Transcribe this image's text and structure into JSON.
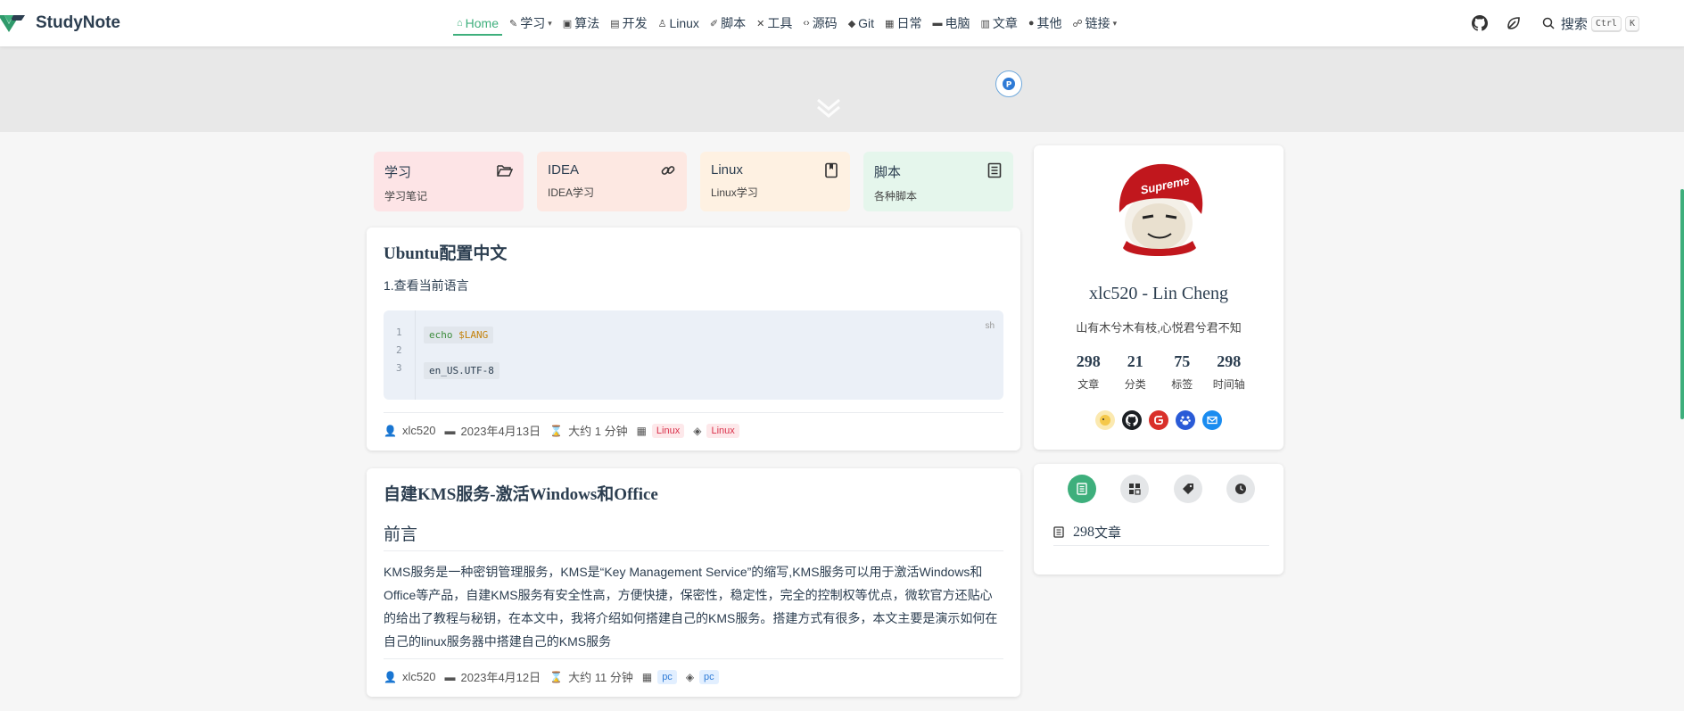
{
  "brand": {
    "name": "StudyNote"
  },
  "nav": {
    "items": [
      {
        "label": "Home",
        "icon": "home-icon",
        "active": true
      },
      {
        "label": "学习",
        "icon": "edit-icon",
        "dropdown": true
      },
      {
        "label": "算法",
        "icon": "terminal-icon"
      },
      {
        "label": "开发",
        "icon": "code-box-icon"
      },
      {
        "label": "Linux",
        "icon": "linux-icon"
      },
      {
        "label": "脚本",
        "icon": "script-icon"
      },
      {
        "label": "工具",
        "icon": "tools-icon"
      },
      {
        "label": "源码",
        "icon": "source-code-icon"
      },
      {
        "label": "Git",
        "icon": "git-icon"
      },
      {
        "label": "日常",
        "icon": "calendar-icon"
      },
      {
        "label": "电脑",
        "icon": "computer-icon"
      },
      {
        "label": "文章",
        "icon": "document-icon"
      },
      {
        "label": "其他",
        "icon": "other-icon"
      },
      {
        "label": "链接",
        "icon": "link-icon",
        "dropdown": true
      }
    ]
  },
  "search": {
    "label": "搜索",
    "key1": "Ctrl",
    "key2": "K"
  },
  "categories": [
    {
      "title": "学习",
      "desc": "学习笔记",
      "icon": "folder-open-icon",
      "bg": "#fde4e6"
    },
    {
      "title": "IDEA",
      "desc": "IDEA学习",
      "icon": "link-icon",
      "bg": "#fde8e2"
    },
    {
      "title": "Linux",
      "desc": "Linux学习",
      "icon": "bookmark-book-icon",
      "bg": "#fef1e2"
    },
    {
      "title": "脚本",
      "desc": "各种脚本",
      "icon": "list-doc-icon",
      "bg": "#e5f6ec"
    }
  ],
  "articles": [
    {
      "title": "Ubuntu配置中文",
      "text": "1.查看当前语言",
      "code": {
        "lang": "sh",
        "lines": [
          "1",
          "2",
          "3"
        ],
        "cmd": "echo",
        "var": "$LANG",
        "output": "en_US.UTF-8"
      },
      "author": "xlc520",
      "date": "2023年4月13日",
      "read_time": "大约 1 分钟",
      "category": "Linux",
      "tag": "Linux"
    },
    {
      "title": "自建KMS服务-激活Windows和Office",
      "subtitle": "前言",
      "body": "KMS服务是一种密钥管理服务，KMS是“Key Management Service”的缩写,KMS服务可以用于激活Windows和Office等产品，自建KMS服务有安全性高，方便快捷，保密性，稳定性，完全的控制权等优点，微软官方还贴心的给出了教程与秘钥，在本文中，我将介绍如何搭建自己的KMS服务。搭建方式有很多，本文主要是演示如何在自己的linux服务器中搭建自己的KMS服务",
      "author": "xlc520",
      "date": "2023年4月12日",
      "read_time": "大约 11 分钟",
      "category": "pc",
      "tag": "pc"
    }
  ],
  "profile": {
    "name": "xlc520 - Lin Cheng",
    "motto": "山有木兮木有枝,心悦君兮君不知",
    "avatar_text": "Supreme",
    "stats": [
      {
        "num": "298",
        "label": "文章"
      },
      {
        "num": "21",
        "label": "分类"
      },
      {
        "num": "75",
        "label": "标签"
      },
      {
        "num": "298",
        "label": "时间轴"
      }
    ],
    "socials": [
      "pokemon-icon",
      "github-icon",
      "gitee-icon",
      "baidu-icon",
      "email-icon"
    ]
  },
  "blog_info": {
    "count": "298",
    "label": "文章"
  },
  "colors": {
    "accent": "#3eaf7c",
    "tag_red": "#d9304a",
    "tag_blue": "#2f7bd6"
  }
}
